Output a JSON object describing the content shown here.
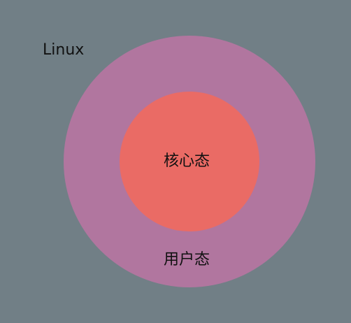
{
  "diagram": {
    "os_label": "Linux",
    "outer_ring": {
      "label": "用户态",
      "color": "#b1769f"
    },
    "inner_circle": {
      "label": "核心态",
      "color": "#ea6b65"
    },
    "background_color": "#717f86"
  }
}
